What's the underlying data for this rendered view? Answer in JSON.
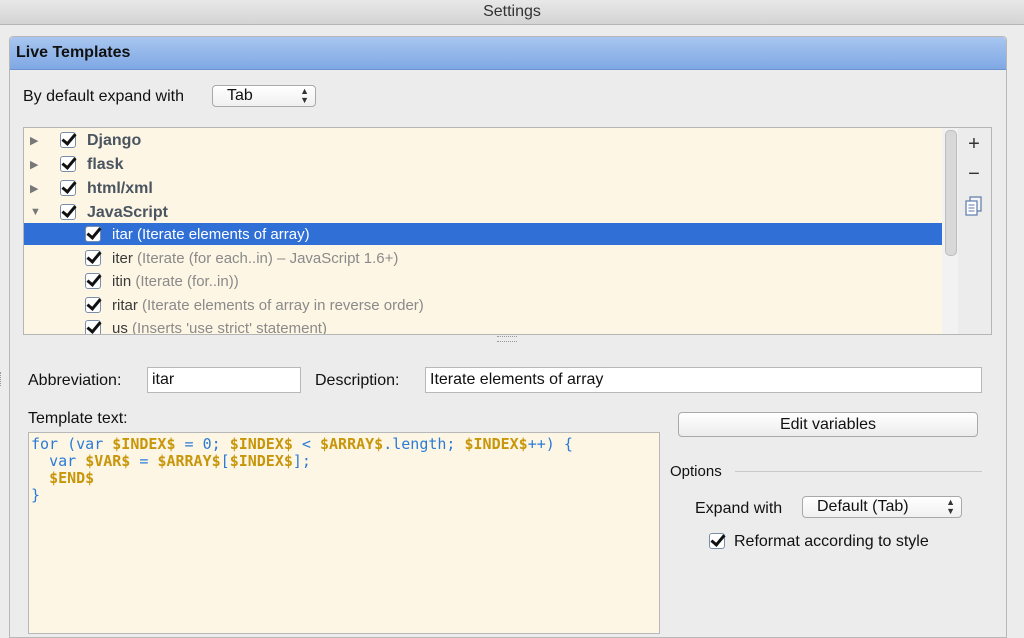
{
  "window": {
    "title": "Settings"
  },
  "panel": {
    "title": "Live Templates"
  },
  "expand_default": {
    "label": "By default expand with",
    "value": "Tab"
  },
  "tree": {
    "groups": [
      {
        "name": "Django",
        "expanded": false,
        "checked": true
      },
      {
        "name": "flask",
        "expanded": false,
        "checked": true
      },
      {
        "name": "html/xml",
        "expanded": false,
        "checked": true
      },
      {
        "name": "JavaScript",
        "expanded": true,
        "checked": true
      }
    ],
    "items": [
      {
        "abbr": "itar",
        "desc": " (Iterate elements of array)",
        "checked": true,
        "selected": true
      },
      {
        "abbr": "iter",
        "desc": " (Iterate (for each..in) – JavaScript 1.6+)",
        "checked": true,
        "selected": false
      },
      {
        "abbr": "itin",
        "desc": " (Iterate (for..in))",
        "checked": true,
        "selected": false
      },
      {
        "abbr": "ritar",
        "desc": " (Iterate elements of array in reverse order)",
        "checked": true,
        "selected": false
      },
      {
        "abbr": "us",
        "desc": " (Inserts 'use strict' statement)",
        "checked": true,
        "selected": false
      }
    ]
  },
  "side_buttons": {
    "add": "+",
    "remove": "−"
  },
  "abbreviation": {
    "label": "Abbreviation:",
    "value": "itar"
  },
  "description": {
    "label": "Description:",
    "value": "Iterate elements of array"
  },
  "template_text": {
    "label": "Template text:",
    "lines": [
      [
        [
          "kw",
          "for ("
        ],
        [
          "kw",
          "var "
        ],
        [
          "var",
          "$INDEX$"
        ],
        [
          "txt",
          " = "
        ],
        [
          "num",
          "0"
        ],
        [
          "txt",
          "; "
        ],
        [
          "var",
          "$INDEX$"
        ],
        [
          "txt",
          " < "
        ],
        [
          "var",
          "$ARRAY$"
        ],
        [
          "txt",
          ".length; "
        ],
        [
          "var",
          "$INDEX$"
        ],
        [
          "txt",
          "++) {"
        ]
      ],
      [
        [
          "txt",
          "  "
        ],
        [
          "kw",
          "var "
        ],
        [
          "var",
          "$VAR$"
        ],
        [
          "txt",
          " = "
        ],
        [
          "var",
          "$ARRAY$"
        ],
        [
          "txt",
          "["
        ],
        [
          "var",
          "$INDEX$"
        ],
        [
          "txt",
          "];"
        ]
      ],
      [
        [
          "txt",
          "  "
        ],
        [
          "var",
          "$END$"
        ]
      ],
      [
        [
          "txt",
          "}"
        ]
      ]
    ]
  },
  "edit_variables": {
    "label": "Edit variables"
  },
  "options": {
    "title": "Options",
    "expand_with": {
      "label": "Expand with",
      "value": "Default (Tab)"
    },
    "reformat": {
      "label": "Reformat according to style",
      "checked": true
    }
  },
  "colors": {
    "selection": "#2f6fd6",
    "header": "#8fb3ea",
    "editor_bg": "#fdf6e5",
    "variable": "#c8960a",
    "code": "#2b7bd6"
  }
}
